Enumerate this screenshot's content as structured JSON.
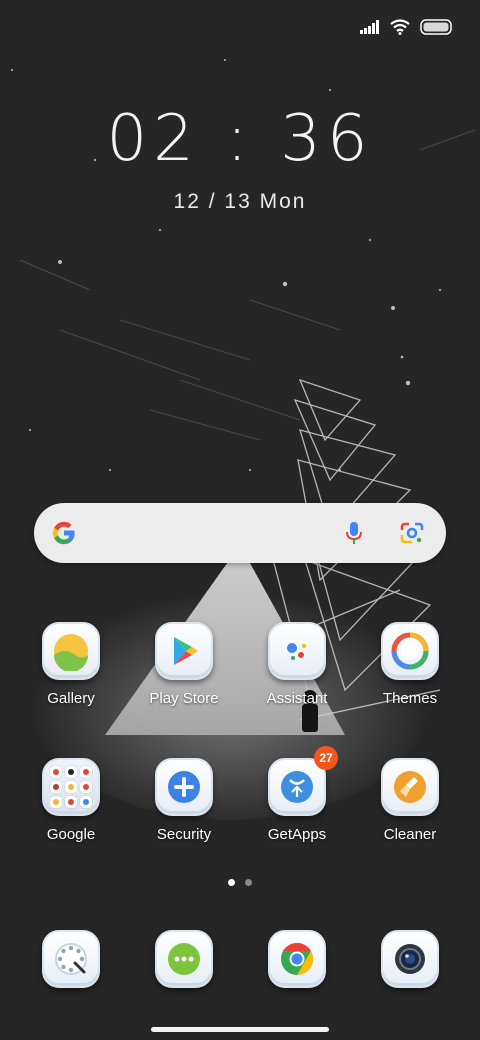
{
  "status_bar": {
    "icons": [
      "signal-icon",
      "wifi-icon",
      "battery-icon"
    ]
  },
  "clock": {
    "time": "02 : 36",
    "date": "12 / 13 Mon"
  },
  "search": {
    "logo": "google-logo-icon",
    "icons": [
      "microphone-icon",
      "google-lens-icon"
    ]
  },
  "apps": [
    {
      "label": "Gallery",
      "icon": "gallery-icon"
    },
    {
      "label": "Play Store",
      "icon": "play-store-icon"
    },
    {
      "label": "Assistant",
      "icon": "assistant-icon"
    },
    {
      "label": "Themes",
      "icon": "themes-icon"
    },
    {
      "label": "Google",
      "icon": "google-folder-icon"
    },
    {
      "label": "Security",
      "icon": "security-icon"
    },
    {
      "label": "GetApps",
      "icon": "getapps-icon",
      "badge": "27"
    },
    {
      "label": "Cleaner",
      "icon": "cleaner-icon"
    }
  ],
  "page_indicator": {
    "count": 2,
    "active": 1
  },
  "dock": [
    {
      "icon": "phone-dialer-icon"
    },
    {
      "icon": "messages-icon"
    },
    {
      "icon": "chrome-icon"
    },
    {
      "icon": "camera-icon"
    }
  ],
  "colors": {
    "background": "#262626",
    "badge": "#f2561d",
    "search_bar": "#ececec"
  }
}
